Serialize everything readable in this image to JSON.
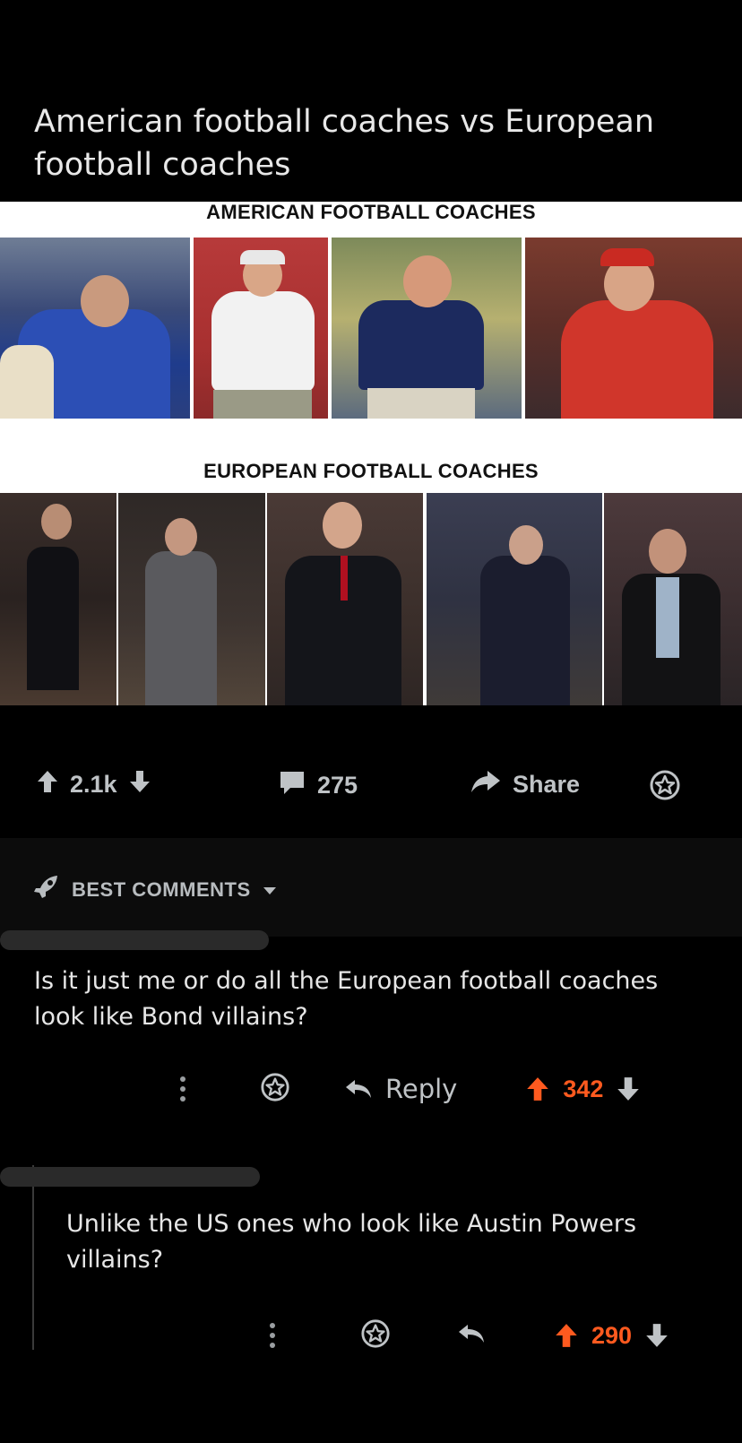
{
  "post": {
    "title": "American football coaches vs European football coaches",
    "image": {
      "top_label": "AMERICAN FOOTBALL COACHES",
      "bottom_label": "EUROPEAN FOOTBALL COACHES"
    },
    "votes": "2.1k",
    "comments_count": "275",
    "share_label": "Share"
  },
  "sort": {
    "label": "BEST COMMENTS"
  },
  "comments": [
    {
      "text": "Is it just me or do all the European football coaches look like Bond villains?",
      "reply_label": "Reply",
      "votes": "342"
    },
    {
      "text": "Unlike the US ones who look like Austin Powers villains?",
      "votes": "290"
    }
  ],
  "colors": {
    "accent": "#ff5a1f",
    "background": "#000000"
  }
}
